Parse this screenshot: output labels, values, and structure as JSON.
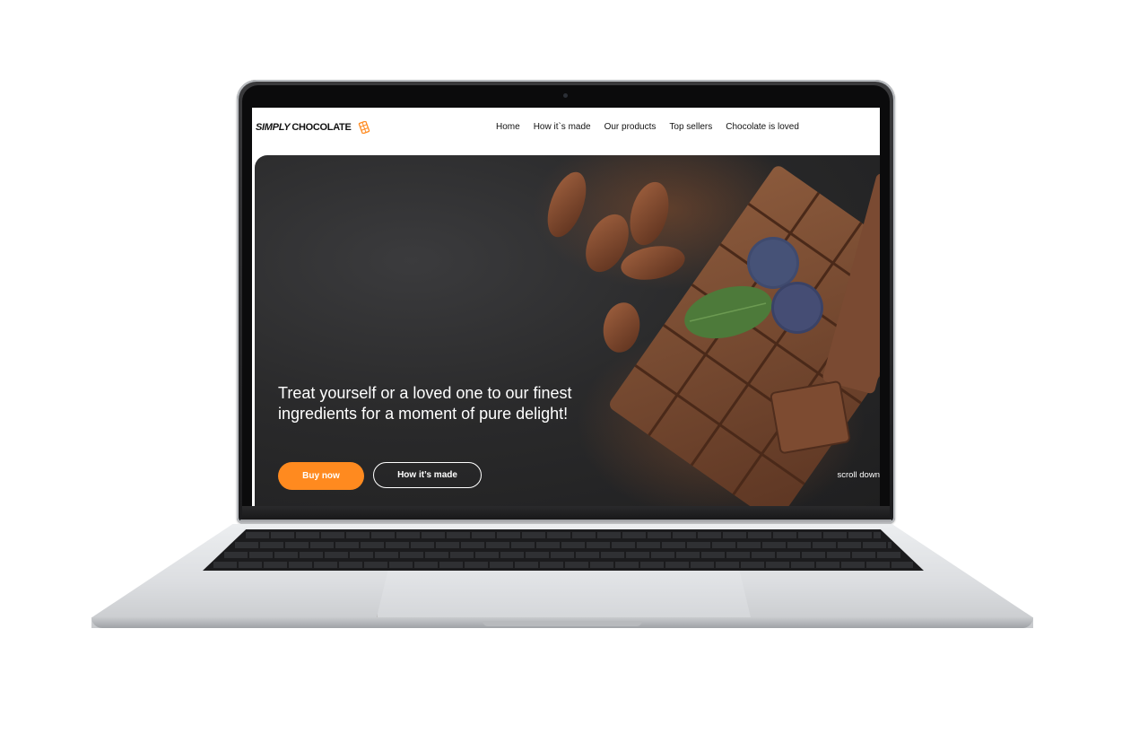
{
  "site": {
    "logo_italic": "SIMPLY",
    "logo_bold": "CHOCOLATE",
    "logo_icon": "chocolate-bar-icon",
    "nav": [
      "Home",
      "How it`s made",
      "Our products",
      "Top sellers",
      "Chocolate is loved"
    ]
  },
  "hero": {
    "headline": "Treat yourself or a loved one to our finest ingredients for a moment of pure delight!",
    "buy_label": "Buy now",
    "how_label": "How it’s made",
    "scroll_label": "scroll down"
  },
  "colors": {
    "accent": "#ff8a1f",
    "hero_background": "#2a2a2b",
    "chocolate": "#7a4a32"
  }
}
